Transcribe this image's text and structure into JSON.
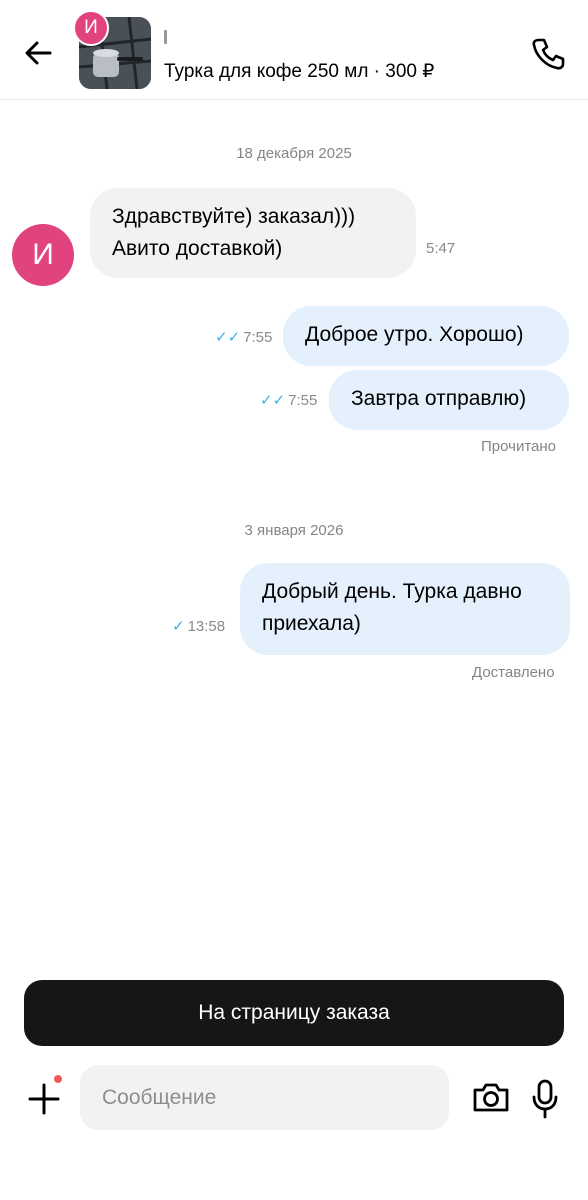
{
  "header": {
    "avatar_letter": "И",
    "title": "Турка для кофе 250 мл · 300 ₽",
    "back_icon": "arrow-left-icon",
    "call_icon": "phone-icon"
  },
  "chat": {
    "avatar_letter": "И",
    "date_1": "18 декабря 2025",
    "messages": [
      {
        "text_line1": "Здравствуйте) заказал)))",
        "text_line2": "Авито доставкой)",
        "time": "5:47"
      },
      {
        "text": "Доброе утро. Хорошо)",
        "time": "7:55",
        "checks": "✓✓"
      },
      {
        "text": "Завтра отправлю)",
        "time": "7:55",
        "checks": "✓✓"
      },
      {
        "text_line1": "Добрый день. Турка давно",
        "text_line2": "приехала)",
        "time": "13:58",
        "checks": "✓"
      }
    ],
    "status_read": "Прочитано",
    "date_2": "3 января 2026",
    "status_delivered": "Доставлено"
  },
  "bottom": {
    "order_button": "На страницу заказа",
    "message_placeholder": "Сообщение",
    "plus_icon": "plus-icon",
    "camera_icon": "camera-icon",
    "mic_icon": "microphone-icon"
  },
  "colors": {
    "accent_avatar": "#e0437e",
    "incoming_bubble": "#f2f2f2",
    "outgoing_bubble": "#e4f1fc",
    "check_blue": "#3cb2e4",
    "order_button_bg": "#161616"
  }
}
